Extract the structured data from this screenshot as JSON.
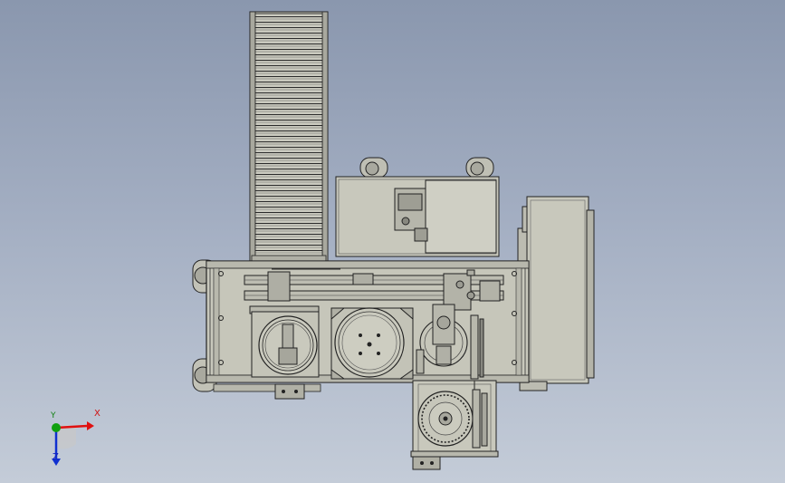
{
  "view": {
    "background_top": "#8a97ae",
    "background_bottom": "#c4ccd8",
    "part_fill": "#c8c8bc",
    "edge_color": "#1e1e1e"
  },
  "triad": {
    "x_label": "X",
    "y_label": "Y",
    "z_label": "Z",
    "x_color": "#e01010",
    "y_color": "#10a010",
    "z_color": "#1030d0"
  }
}
